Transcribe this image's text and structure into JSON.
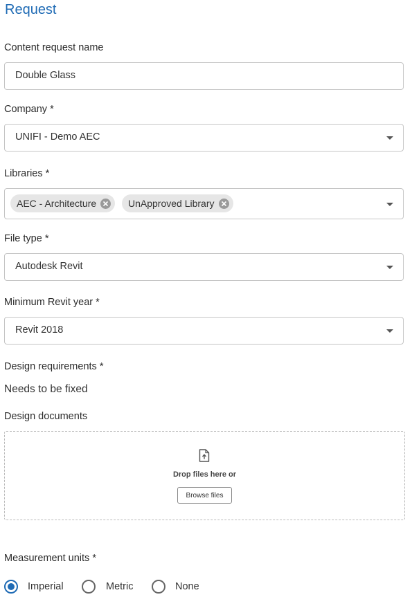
{
  "header": {
    "title": "Request"
  },
  "form": {
    "content_request_name": {
      "label": "Content request name",
      "value": "Double Glass"
    },
    "company": {
      "label": "Company *",
      "value": "UNIFI - Demo AEC"
    },
    "libraries": {
      "label": "Libraries *",
      "chips": [
        "AEC - Architecture",
        "UnApproved Library"
      ]
    },
    "file_type": {
      "label": "File type *",
      "value": "Autodesk Revit"
    },
    "min_revit_year": {
      "label": "Minimum Revit year *",
      "value": "Revit 2018"
    },
    "design_requirements": {
      "label": "Design requirements *",
      "value": "Needs to be fixed"
    },
    "design_documents": {
      "label": "Design documents",
      "drop_text": "Drop files here or",
      "browse_label": "Browse files"
    },
    "measurement_units": {
      "label": "Measurement units *",
      "options": [
        "Imperial",
        "Metric",
        "None"
      ],
      "selected": "Imperial"
    }
  },
  "colors": {
    "accent": "#1f6bb5",
    "border": "#c5c5c5",
    "chip_bg": "#e6e6e6"
  },
  "icons": {
    "upload": "file-upload-icon",
    "chip_remove": "close-circle-icon",
    "dropdown": "chevron-down-icon"
  }
}
